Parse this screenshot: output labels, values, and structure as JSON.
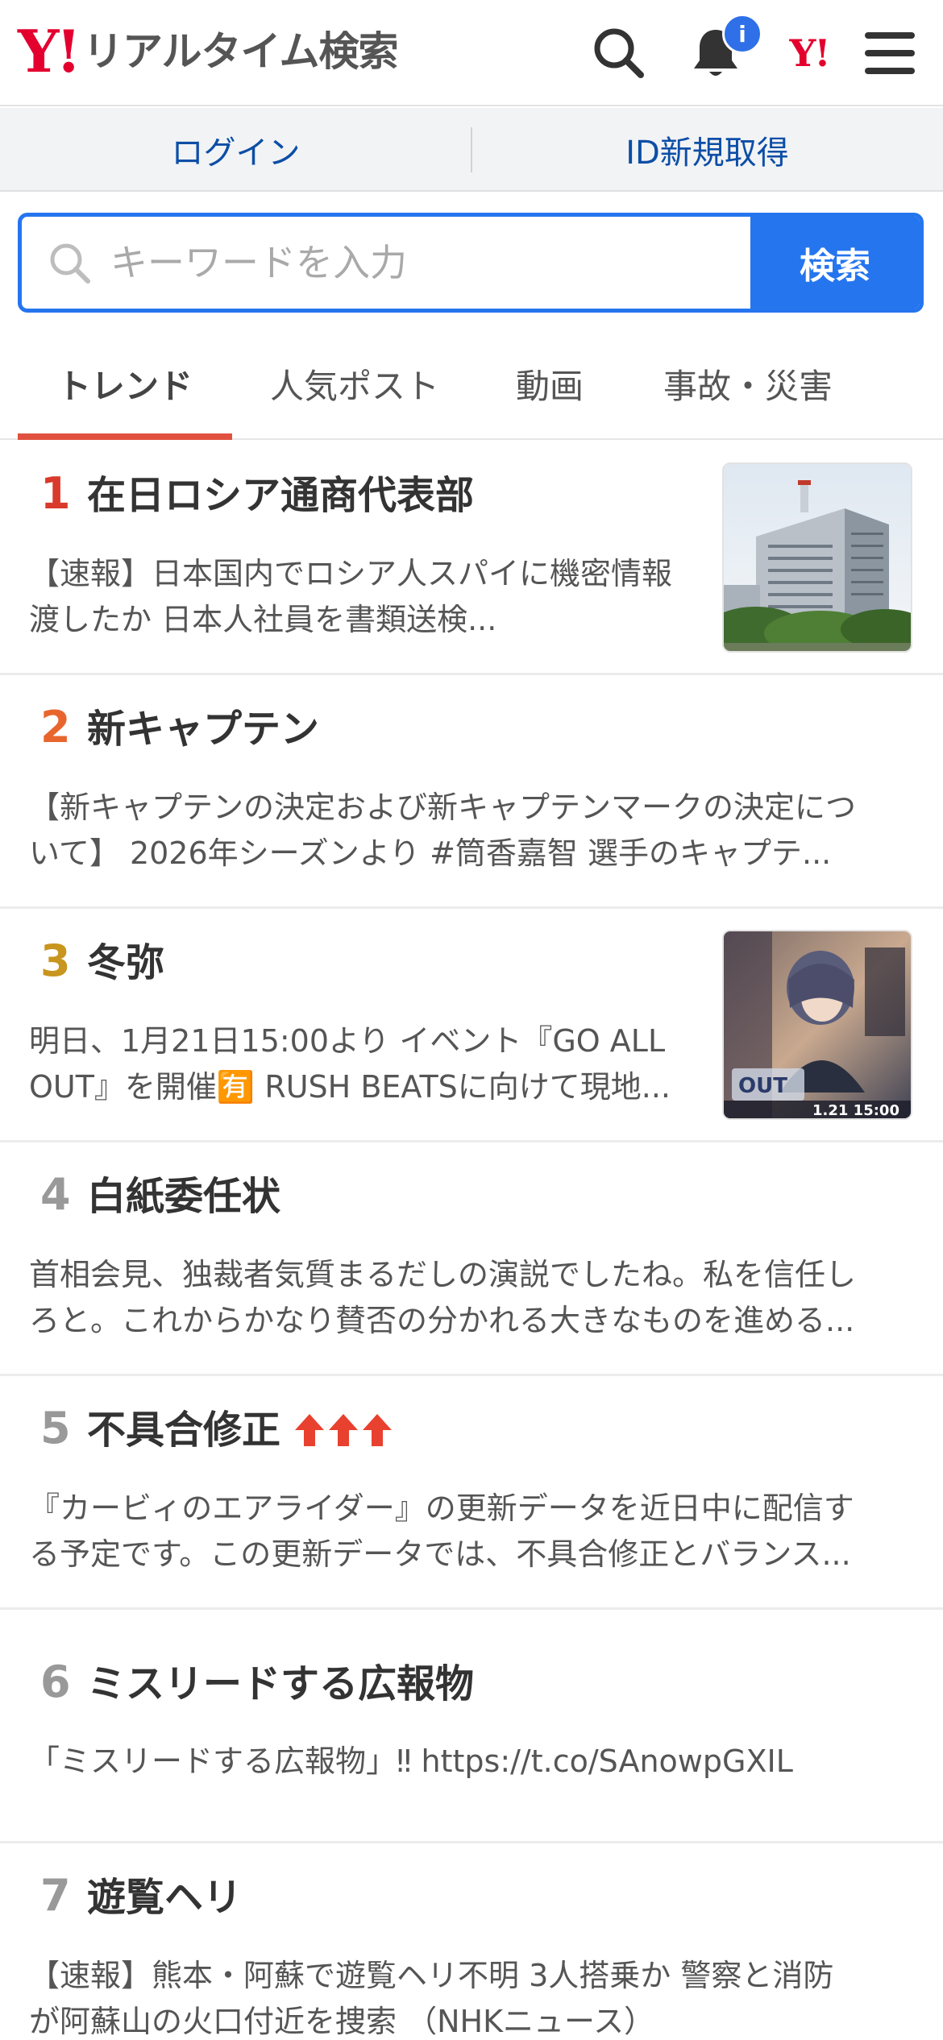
{
  "header": {
    "logo_mark": "Y!",
    "logo_text": "リアルタイム検索",
    "notification_badge": "i",
    "yahoo_mini": "Y!",
    "icons": [
      "search-icon",
      "bell-icon",
      "yahoo-logo-icon",
      "hamburger-menu-icon"
    ],
    "brand_color": "#e3002f"
  },
  "loginbar": {
    "login": "ログイン",
    "signup": "ID新規取得"
  },
  "search": {
    "placeholder": "キーワードを入力",
    "value": "",
    "button": "検索",
    "accent": "#2575ef"
  },
  "tabs": [
    {
      "label": "トレンド",
      "active": true
    },
    {
      "label": "人気ポスト",
      "active": false
    },
    {
      "label": "動画",
      "active": false
    },
    {
      "label": "事故・災害",
      "active": false
    }
  ],
  "trends": [
    {
      "rank": "1",
      "rank_color": "#d93a2b",
      "title": "在日ロシア通商代表部",
      "desc": [
        "【速報】日本国内でロシア人スパイに機密情報",
        "渡したか 日本人社員を書類送検..."
      ],
      "has_thumb": true
    },
    {
      "rank": "2",
      "rank_color": "#e8662e",
      "title": "新キャプテン",
      "desc": [
        "【新キャプテンの決定および新キャプテンマークの決定につ",
        "いて】 2026年シーズンより #筒香嘉智 選手のキャプテ..."
      ],
      "has_thumb": false
    },
    {
      "rank": "3",
      "rank_color": "#c8951e",
      "title": "冬弥",
      "desc": [
        "明日、1月21日15:00より イベント『GO ALL",
        "OUT』を開催🈶 RUSH BEATSに向けて現地..."
      ],
      "has_thumb": true,
      "thumb_caption": "1.21 15:00"
    },
    {
      "rank": "4",
      "rank_color": "#999999",
      "title": "白紙委任状",
      "desc": [
        "首相会見、独裁者気質まるだしの演説でしたね。私を信任し",
        "ろと。これからかなり賛否の分かれる大きなものを進める..."
      ],
      "has_thumb": false
    },
    {
      "rank": "5",
      "rank_color": "#999999",
      "title": "不具合修正",
      "trend_arrows": 3,
      "desc": [
        "『カービィのエアライダー』の更新データを近日中に配信す",
        "る予定です。この更新データでは、不具合修正とバランス..."
      ],
      "has_thumb": false
    },
    {
      "rank": "6",
      "rank_color": "#999999",
      "title": "ミスリードする広報物",
      "desc": [
        "「ミスリードする広報物」‼ https://t.co/SAnowpGXIL"
      ],
      "has_thumb": false
    },
    {
      "rank": "7",
      "rank_color": "#999999",
      "title": "遊覧ヘリ",
      "desc": [
        "【速報】熊本・阿蘇で遊覧ヘリ不明 3人搭乗か 警察と消防",
        "が阿蘇山の火口付近を捜索 （NHKニュース）"
      ],
      "has_thumb": false
    }
  ]
}
